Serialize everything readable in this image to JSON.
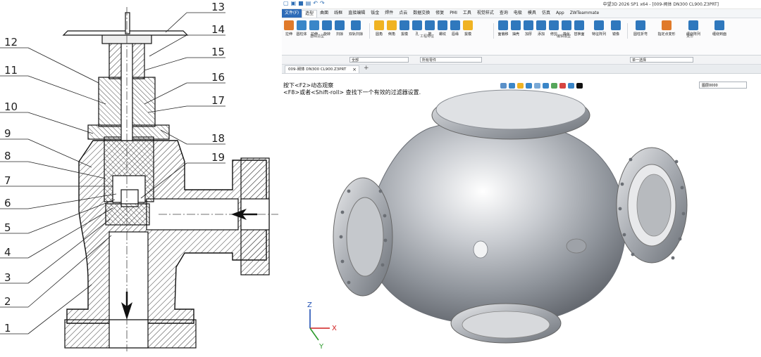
{
  "drawing": {
    "callouts": [
      "1",
      "2",
      "3",
      "4",
      "5",
      "6",
      "7",
      "8",
      "9",
      "10",
      "11",
      "12",
      "13",
      "14",
      "15",
      "16",
      "17",
      "18",
      "19"
    ]
  },
  "app": {
    "title": "中望3D 2026 SP1 x64 - [009-阀体 DN300 CL900.Z3PRT]",
    "menu": [
      "文件(F)",
      "造型",
      "曲面",
      "线框",
      "直接编辑",
      "钣金",
      "焊件",
      "点云",
      "数据交换",
      "修复",
      "PMI",
      "工具",
      "视觉样式",
      "查询",
      "电极",
      "模具",
      "仿真",
      "App",
      "ZWTeammate"
    ],
    "ribbon": {
      "basic_group": "基础造型",
      "eng_group": "工程特征",
      "edit_group": "编辑模型",
      "deform_group": "变形",
      "tools": [
        "拉伸",
        "圆柱体",
        "拉伸",
        "旋转",
        "扫掠",
        "双轨扫掠",
        "圆角",
        "倒角",
        "拔模",
        "孔",
        "筋",
        "螺纹",
        "唇缘",
        "拔模",
        "面偏移",
        "抽壳",
        "加厚",
        "添加",
        "修剪",
        "简化",
        "替换面",
        "特征阵列",
        "镜像",
        "圆柱折弯",
        "指定点变形",
        "缠绕阵列",
        "缠绕到面"
      ]
    },
    "filter": {
      "scope": "全部",
      "parts": "所有零件",
      "select_mode": "单一选择"
    },
    "doc_tab": "009-阀体 DN300 CL900.Z3PRT",
    "hint_line1": "按下<F2>动态观察",
    "hint_line2": "<F8>或者<Shift-roll> 查找下一个有效的过滤器设置.",
    "layer": "图层0000",
    "axes": {
      "x": "X",
      "y": "Y",
      "z": "Z"
    }
  }
}
